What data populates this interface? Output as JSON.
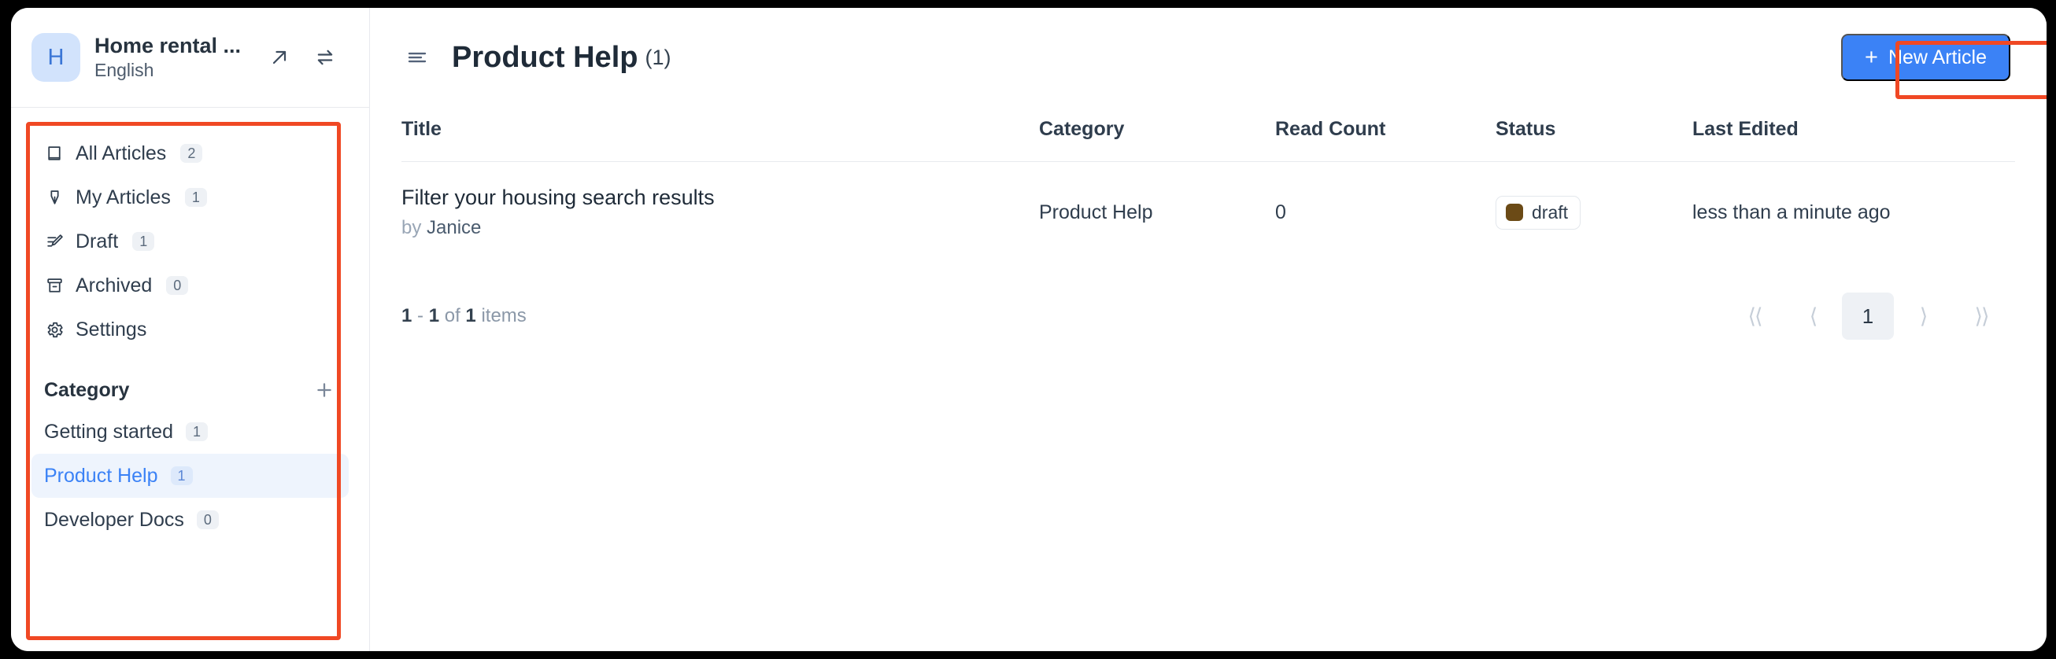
{
  "workspace": {
    "avatar_initial": "H",
    "name": "Home rental ...",
    "language": "English",
    "open_external_icon": "external-link-arrow-icon",
    "switch_icon": "swap-arrows-icon"
  },
  "sidebar": {
    "nav_items": [
      {
        "label": "All Articles",
        "count": "2",
        "icon": "book-icon"
      },
      {
        "label": "My Articles",
        "count": "1",
        "icon": "pen-nib-icon"
      },
      {
        "label": "Draft",
        "count": "1",
        "icon": "pencil-lines-icon"
      },
      {
        "label": "Archived",
        "count": "0",
        "icon": "archive-box-icon"
      },
      {
        "label": "Settings",
        "count": "",
        "icon": "gear-icon"
      }
    ],
    "category_section": {
      "title": "Category",
      "add_icon": "plus-icon",
      "items": [
        {
          "label": "Getting started",
          "count": "1",
          "active": false
        },
        {
          "label": "Product Help",
          "count": "1",
          "active": true
        },
        {
          "label": "Developer Docs",
          "count": "0",
          "active": false
        }
      ]
    }
  },
  "main": {
    "menu_icon": "hamburger-menu-icon",
    "title": "Product Help",
    "count_label": "(1)",
    "new_article_button": {
      "label": "New Article",
      "plus": "+",
      "color": "#3b82f6"
    },
    "table": {
      "columns": [
        "Title",
        "Category",
        "Read Count",
        "Status",
        "Last Edited"
      ],
      "rows": [
        {
          "title": "Filter your housing search results",
          "by_prefix": "by",
          "author": "Janice",
          "category": "Product Help",
          "read_count": "0",
          "status": "draft",
          "status_color": "#6b4a16",
          "last_edited": "less than a minute ago"
        }
      ]
    },
    "footer": {
      "range_start": "1",
      "dash": "-",
      "range_end": "1",
      "of_label": "of",
      "total": "1",
      "items_label": "items",
      "pagination": {
        "first": "⟨⟨",
        "prev": "⟨",
        "current_page": "1",
        "next": "⟩",
        "last": "⟩⟩"
      }
    }
  },
  "annotations": {
    "accent_color": "#f04824",
    "boxes": [
      "sidebar-navigation-highlight",
      "new-article-button-highlight"
    ]
  }
}
